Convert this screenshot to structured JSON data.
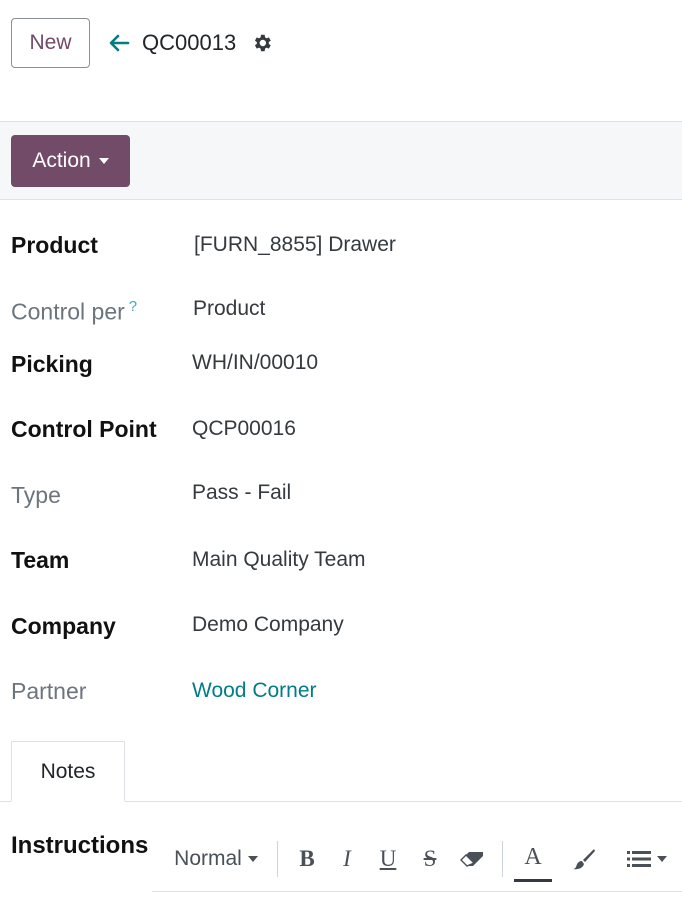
{
  "header": {
    "new_label": "New",
    "record_name": "QC00013"
  },
  "actions": {
    "action_label": "Action"
  },
  "fields": [
    {
      "label": "Product",
      "value": "[FURN_8855] Drawer"
    },
    {
      "label": "Control per",
      "value": "Product",
      "help": "?"
    },
    {
      "label": "Picking",
      "value": "WH/IN/00010"
    },
    {
      "label": "Control Point",
      "value": "QCP00016"
    },
    {
      "label": "Type",
      "value": "Pass - Fail"
    },
    {
      "label": "Team",
      "value": "Main Quality Team"
    },
    {
      "label": "Company",
      "value": "Demo Company"
    },
    {
      "label": "Partner",
      "value": "Wood Corner"
    }
  ],
  "tabs": [
    {
      "label": "Notes"
    }
  ],
  "instructions": {
    "label": "Instructions",
    "style_select": "Normal",
    "tools": [
      "bold-icon",
      "italic-icon",
      "underline-icon",
      "strikethrough-icon",
      "eraser-icon",
      "font-color-icon",
      "background-color-icon",
      "list-icon"
    ]
  },
  "colors": {
    "brand": "#714b67",
    "link": "#017e84"
  }
}
